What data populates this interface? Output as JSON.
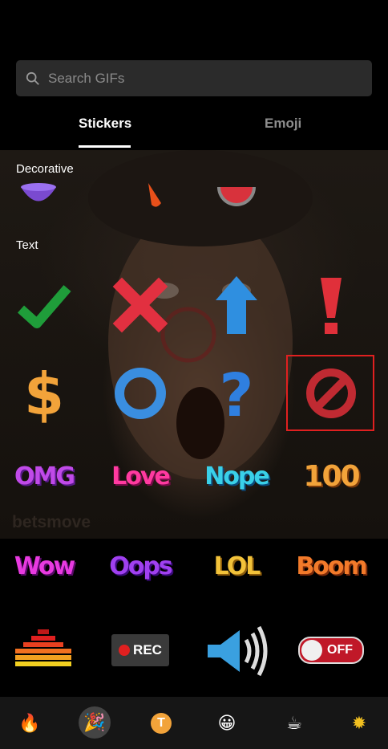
{
  "search": {
    "placeholder": "Search GIFs"
  },
  "tabs": {
    "stickers": "Stickers",
    "emoji": "Emoji"
  },
  "sections": {
    "decorative": "Decorative",
    "text": "Text"
  },
  "watermark": "betsmove",
  "stickers": {
    "omg": "OMG",
    "love": "Love",
    "nope": "Nope",
    "hundred": "100",
    "wow": "Wow",
    "oops": "Oops",
    "lol": "LOL",
    "boom": "Boom",
    "rec": "REC",
    "off": "OFF"
  },
  "bottom_tabs": [
    "fire-icon",
    "party-popper-icon",
    "text-t-icon",
    "smile-icon",
    "coffee-icon",
    "sparkle-icon"
  ],
  "colors": {
    "selection": "#e02020",
    "accent_orange": "#f2a33a"
  }
}
